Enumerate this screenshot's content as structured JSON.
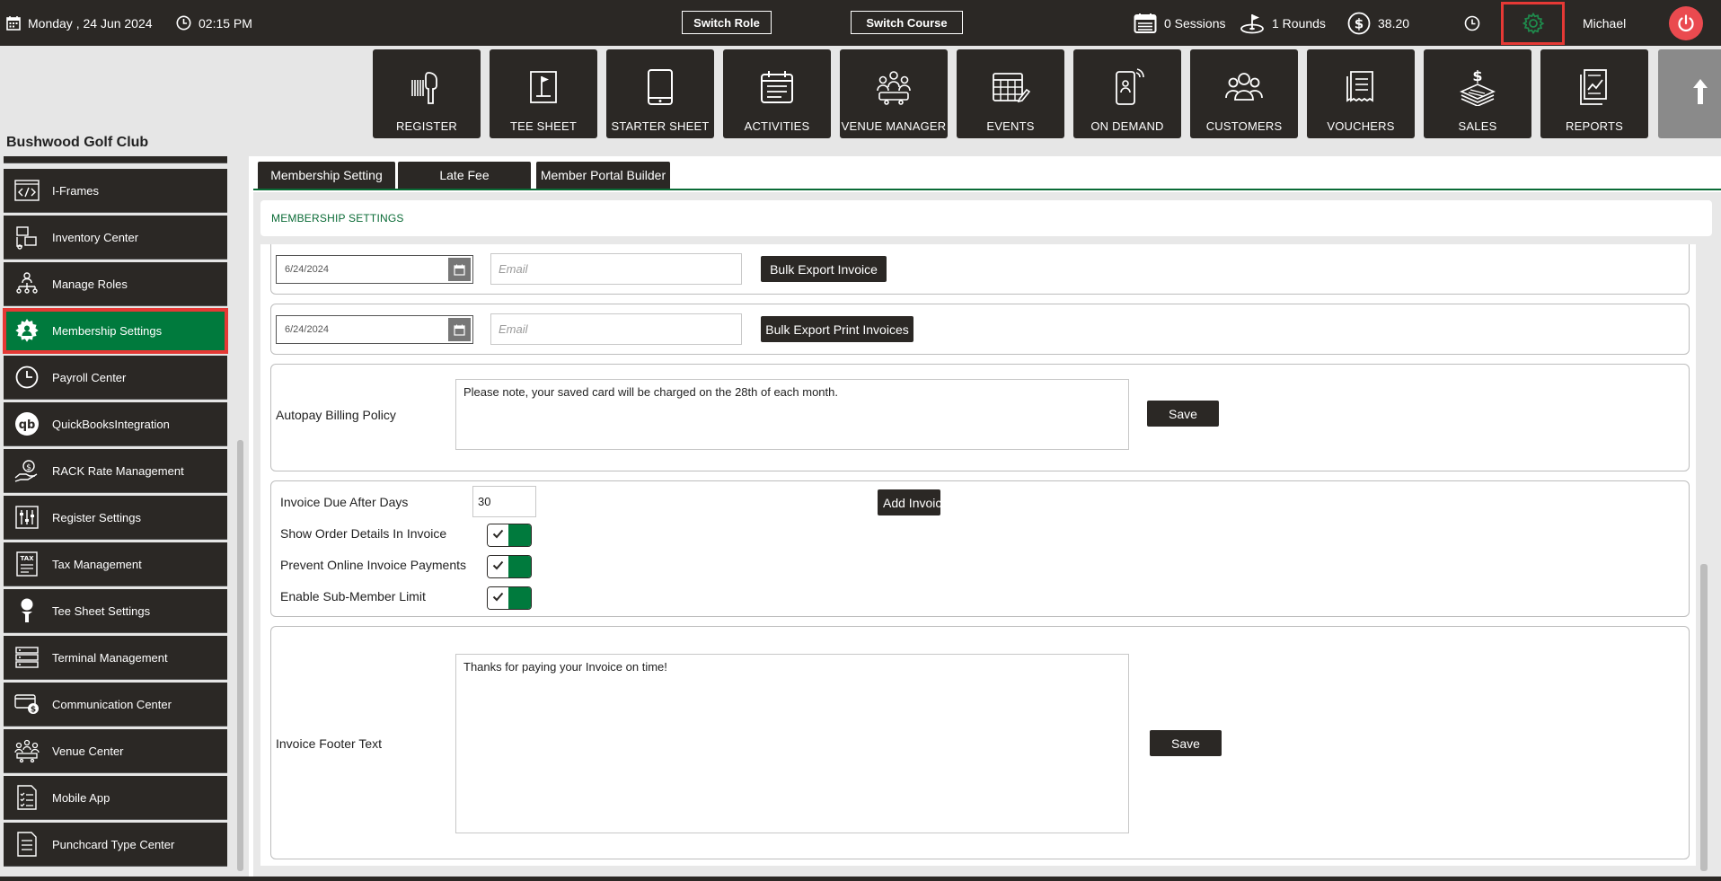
{
  "topbar": {
    "date": "Monday ,  24 Jun 2024",
    "time": "02:15 PM",
    "switch_role": "Switch Role",
    "switch_course": "Switch Course",
    "sessions": "0 Sessions",
    "rounds": "1 Rounds",
    "balance": "38.20",
    "user": "Michael"
  },
  "tiles": [
    {
      "label": "REGISTER",
      "icon": "barcode-scanner-icon"
    },
    {
      "label": "TEE SHEET",
      "icon": "flag-sheet-icon"
    },
    {
      "label": "STARTER SHEET",
      "icon": "tablet-icon"
    },
    {
      "label": "ACTIVITIES",
      "icon": "calendar-list-icon"
    },
    {
      "label": "VENUE MANAGER",
      "icon": "people-table-icon"
    },
    {
      "label": "EVENTS",
      "icon": "calendar-pen-icon"
    },
    {
      "label": "ON DEMAND",
      "icon": "phone-person-icon"
    },
    {
      "label": "CUSTOMERS",
      "icon": "group-icon"
    },
    {
      "label": "VOUCHERS",
      "icon": "receipt-icon"
    },
    {
      "label": "SALES",
      "icon": "money-stack-icon"
    },
    {
      "label": "REPORTS",
      "icon": "report-chart-icon"
    }
  ],
  "club_name": "Bushwood Golf Club",
  "sidebar": {
    "items": [
      {
        "label": "I-Frames",
        "icon": "code-icon"
      },
      {
        "label": "Inventory Center",
        "icon": "inventory-icon"
      },
      {
        "label": "Manage Roles",
        "icon": "roles-hierarchy-icon"
      },
      {
        "label": "Membership Settings",
        "icon": "gear-person-icon"
      },
      {
        "label": "Payroll Center",
        "icon": "clock-icon"
      },
      {
        "label": "QuickBooksIntegration",
        "icon": "quickbooks-icon"
      },
      {
        "label": "RACK Rate Management",
        "icon": "hand-dollar-icon"
      },
      {
        "label": "Register Settings",
        "icon": "sliders-icon"
      },
      {
        "label": "Tax Management",
        "icon": "tax-document-icon"
      },
      {
        "label": "Tee Sheet Settings",
        "icon": "golf-tee-icon"
      },
      {
        "label": "Terminal Management",
        "icon": "server-icon"
      },
      {
        "label": "Communication Center",
        "icon": "card-dollar-icon"
      },
      {
        "label": "Venue Center",
        "icon": "meeting-icon"
      },
      {
        "label": "Mobile App",
        "icon": "checklist-icon"
      },
      {
        "label": "Punchcard Type Center",
        "icon": "list-document-icon"
      }
    ]
  },
  "tabs": [
    "Membership Setting",
    "Late Fee",
    "Member Portal Builder"
  ],
  "section_title": "MEMBERSHIP SETTINGS",
  "export_rows": [
    {
      "date": "6/24/2024",
      "email_placeholder": "Email",
      "button": "Bulk Export Invoice"
    },
    {
      "date": "6/24/2024",
      "email_placeholder": "Email",
      "button": "Bulk Export Print Invoices"
    }
  ],
  "autopay": {
    "label": "Autopay Billing Policy",
    "text": "Please note, your saved card will be charged on the 28th of each month.",
    "save": "Save"
  },
  "invoice": {
    "due_label": "Invoice Due After Days",
    "due_value": "30",
    "add_button": "Add Invoic",
    "toggles": [
      {
        "label": "Show Order Details In Invoice",
        "checked": true
      },
      {
        "label": "Prevent Online Invoice Payments",
        "checked": true
      },
      {
        "label": "Enable Sub-Member Limit",
        "checked": true
      }
    ]
  },
  "footer": {
    "label": "Invoice Footer Text",
    "text": "Thanks for paying your Invoice on time!",
    "save": "Save"
  },
  "colors": {
    "dark": "#2b2825",
    "green": "#007a3d",
    "highlight": "#e53935",
    "power": "#ea4a4f"
  }
}
